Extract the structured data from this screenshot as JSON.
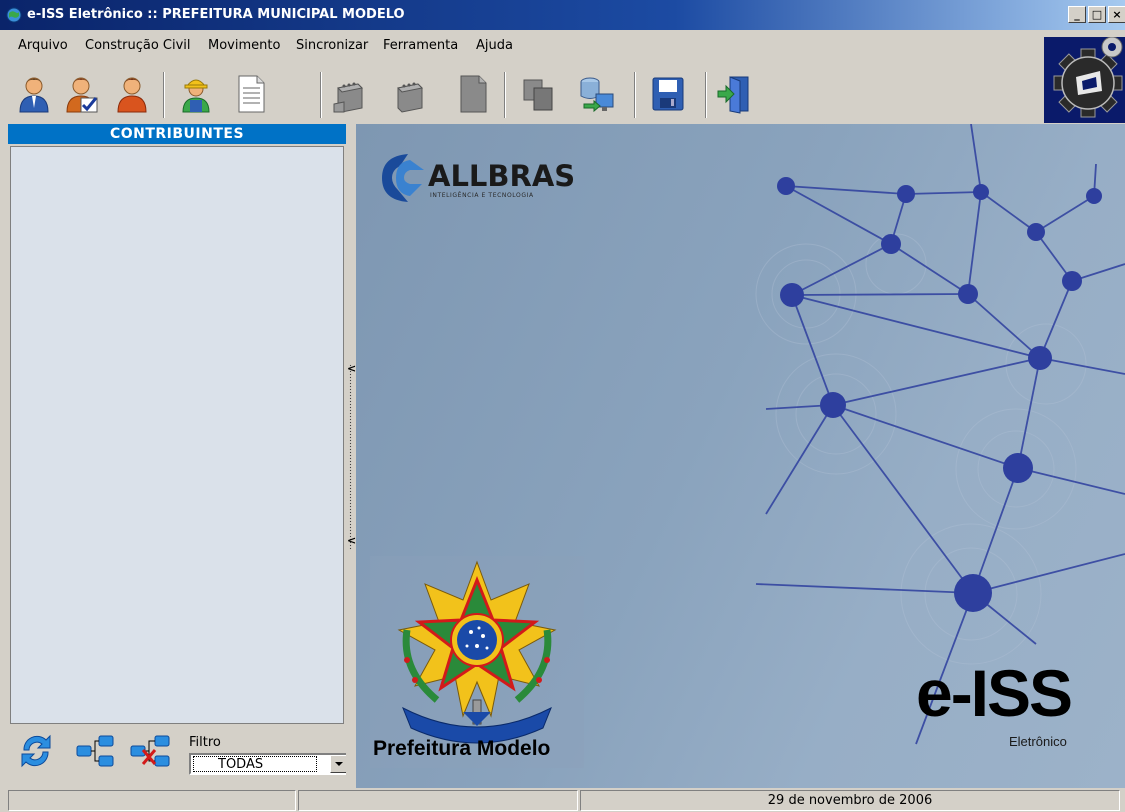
{
  "window": {
    "title": "e-ISS Eletrônico :: PREFEITURA MUNICIPAL MODELO",
    "controls": [
      "_",
      "□",
      "×"
    ]
  },
  "menu": {
    "items": [
      "Arquivo",
      "Construção Civil",
      "Movimento",
      "Sincronizar",
      "Ferramenta",
      "Ajuda"
    ]
  },
  "toolbar": {
    "buttons": [
      {
        "icon": "user-icon",
        "enabled": true
      },
      {
        "icon": "user-check-icon",
        "enabled": true
      },
      {
        "icon": "user-orange-icon",
        "enabled": true
      },
      {
        "icon": "construction-worker-icon",
        "enabled": true
      },
      {
        "icon": "document-icon",
        "enabled": true
      },
      {
        "icon": "stamp-icon",
        "enabled": false
      },
      {
        "icon": "stamp-icon",
        "enabled": false
      },
      {
        "icon": "document-dark-icon",
        "enabled": false
      },
      {
        "icon": "copy-icon",
        "enabled": false
      },
      {
        "icon": "database-sync-icon",
        "enabled": true
      },
      {
        "icon": "save-icon",
        "enabled": true
      },
      {
        "icon": "exit-icon",
        "enabled": true
      }
    ]
  },
  "left_panel": {
    "title": "CONTRIBUINTES",
    "filter_label": "Filtro",
    "filter_value": "TODAS"
  },
  "main": {
    "vendor": "ALLBRAS",
    "vendor_tagline": "INTELIGÊNCIA E TECNOLOGIA",
    "municipality": "Prefeitura Modelo",
    "product": "e-ISS",
    "product_sub": "Eletrônico"
  },
  "statusbar": {
    "panel1": "",
    "panel2": "",
    "date": "29 de novembro de 2006"
  },
  "colors": {
    "titlebar": "#0a246a",
    "panel_header": "#0072c6",
    "list_bg": "#dae1ea",
    "main_bg": "#8aa3bd",
    "network_node": "#2e3f9e"
  }
}
